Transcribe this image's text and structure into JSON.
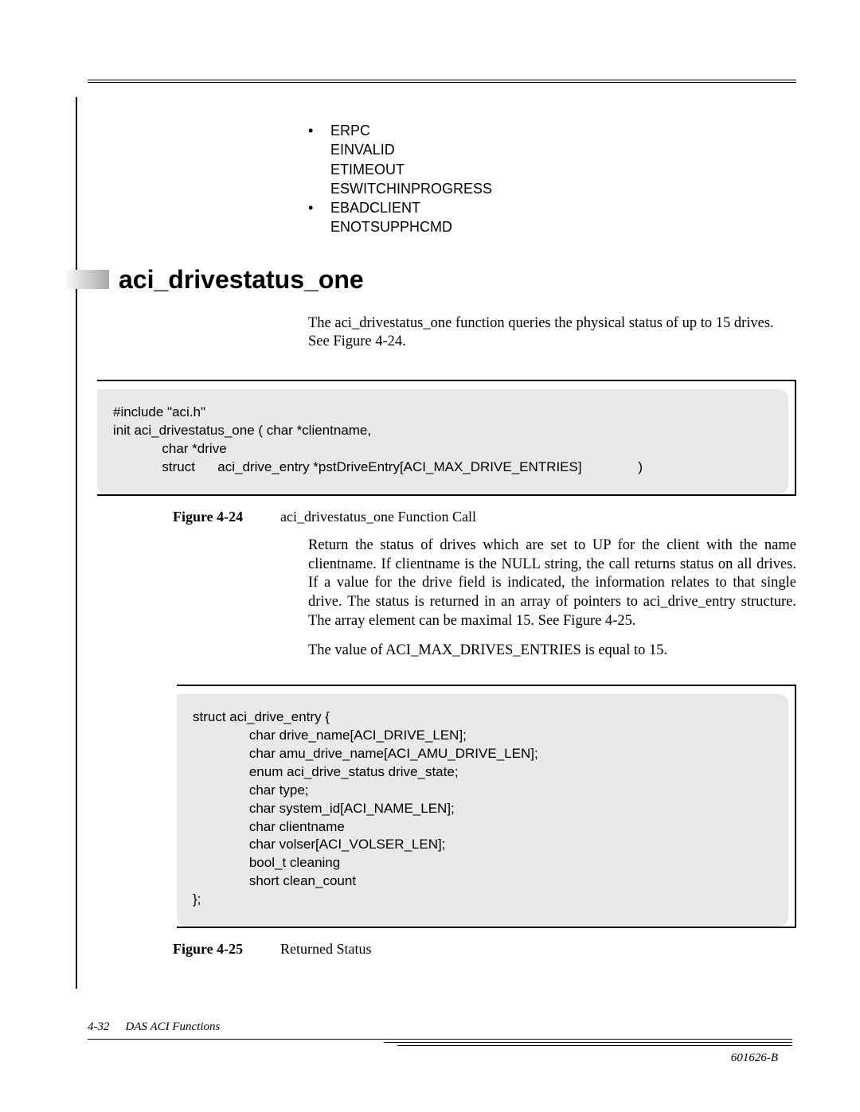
{
  "errors": {
    "b1": "ERPC",
    "e1a": "EINVALID",
    "e1b": "ETIMEOUT",
    "e1c": "ESWITCHINPROGRESS",
    "b2": "EBADCLIENT",
    "e2a": "ENOTSUPPHCMD"
  },
  "section": {
    "title": "aci_drivestatus_one",
    "desc": "The aci_drivestatus_one function queries the physical status of up to 15 drives. See Figure 4-24."
  },
  "code1": "#include \"aci.h\"\ninit aci_drivestatus_one ( char *clientname,\n             char *drive\n             struct      aci_drive_entry *pstDriveEntry[ACI_MAX_DRIVE_ENTRIES]               )",
  "fig1": {
    "label": "Figure 4-24",
    "text": "aci_drivestatus_one Function Call"
  },
  "para1": "Return the status of drives which are set to UP for the client with the name clientname. If clientname is the NULL string, the call returns status on all drives. If a value for the drive field is indicated, the information relates to that single drive. The status is returned in an array of pointers to aci_drive_entry structure. The array element can be maximal 15. See Figure 4-25.",
  "para2": "The value of ACI_MAX_DRIVES_ENTRIES is equal to 15.",
  "code2": "struct aci_drive_entry {\n               char drive_name[ACI_DRIVE_LEN];\n               char amu_drive_name[ACI_AMU_DRIVE_LEN];\n               enum aci_drive_status drive_state;\n               char type;\n               char system_id[ACI_NAME_LEN];\n               char clientname\n               char volser[ACI_VOLSER_LEN];\n               bool_t cleaning\n               short clean_count\n};",
  "fig2": {
    "label": "Figure 4-25",
    "text": "Returned Status"
  },
  "footer": {
    "pagenum": "4-32",
    "chapter": "DAS ACI Functions",
    "docid": "601626-B"
  }
}
